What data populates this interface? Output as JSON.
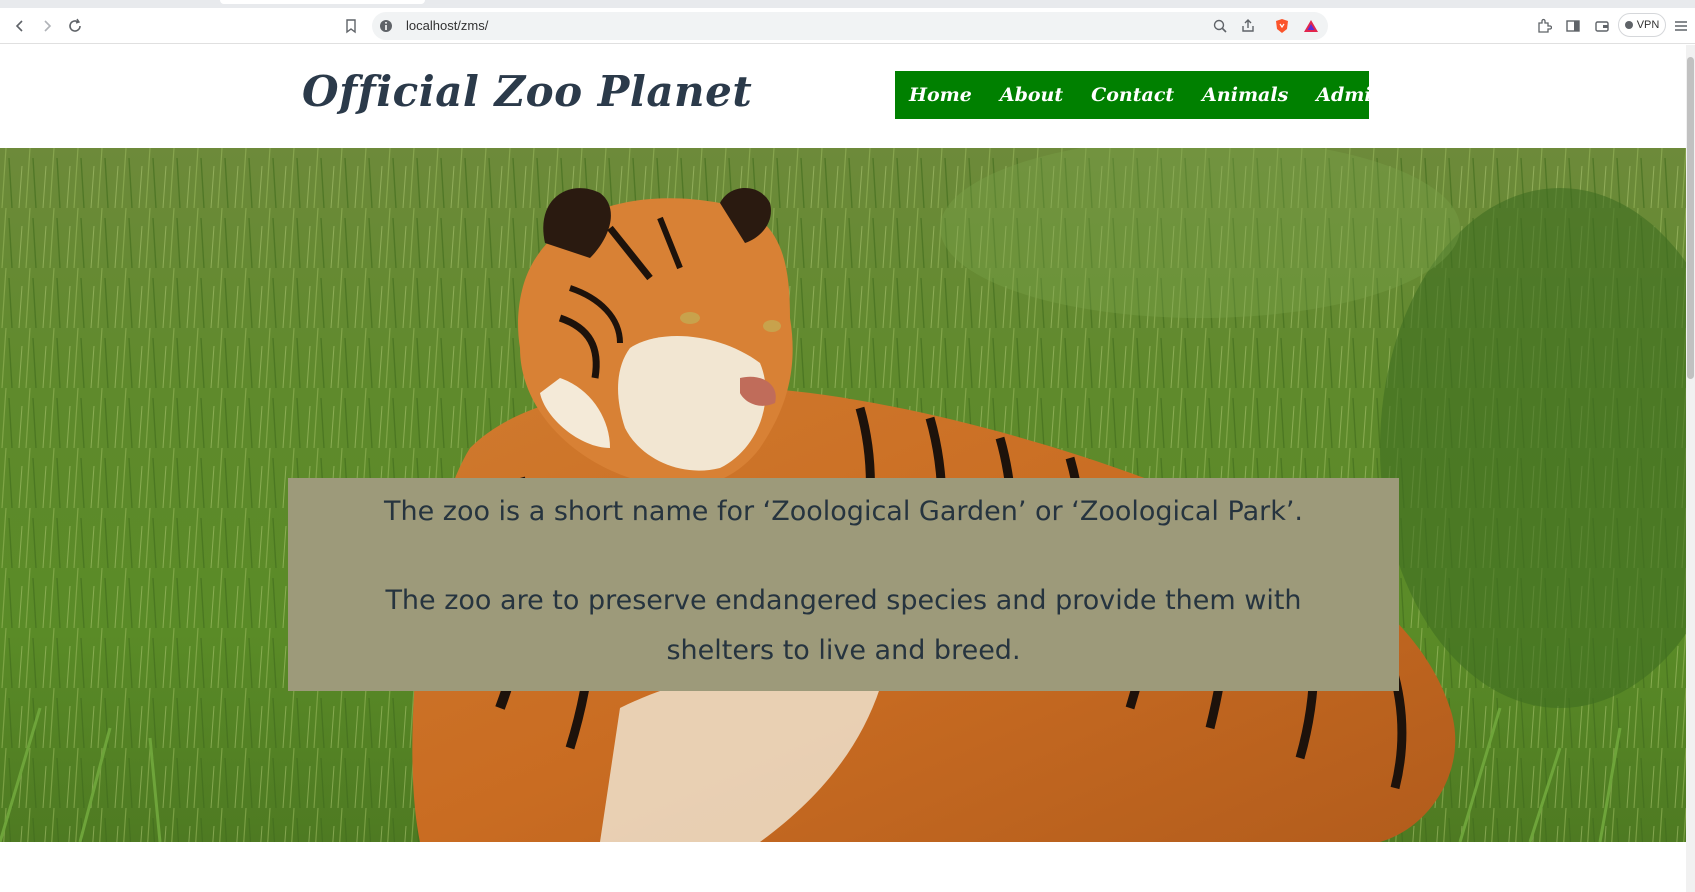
{
  "browser": {
    "url": "localhost/zms/",
    "vpn_label": "VPN"
  },
  "site": {
    "title": "Official Zoo Planet"
  },
  "nav": {
    "items": [
      {
        "label": "Home"
      },
      {
        "label": "About"
      },
      {
        "label": "Contact"
      },
      {
        "label": "Animals"
      },
      {
        "label": "Admin"
      }
    ]
  },
  "hero": {
    "image": "tiger-in-grass",
    "caption_line1": "The zoo is a short name for ‘Zoological Garden’ or ‘Zoological Park’.",
    "caption_line2": "The zoo are to preserve endangered species and provide them with shelters to live and breed."
  },
  "colors": {
    "nav_bg": "#008000",
    "caption_bg": "#9d9a7a",
    "title_color": "#2b3a4a"
  }
}
